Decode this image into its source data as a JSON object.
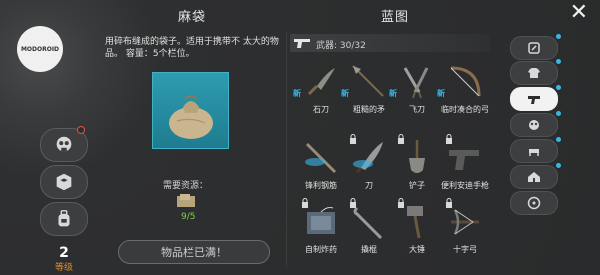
{
  "header": {
    "left_title": "麻袋",
    "right_title": "蓝图"
  },
  "logo_text": "MODOROID",
  "item": {
    "description": "用碎布缝成的袋子。适用于携带不 太大的物品。 容量：5个栏位。",
    "required_label": "需要资源：",
    "resource_count": "9/5",
    "action_button": "物品栏已满！"
  },
  "player": {
    "level": "2",
    "level_label": "等级"
  },
  "category": {
    "icon": "pistol-icon",
    "label": "武器: 30/32"
  },
  "blueprints": [
    {
      "name": "石刀",
      "new": "新",
      "locked": false,
      "icon": "stone-knife-icon"
    },
    {
      "name": "粗糙的矛",
      "new": "新",
      "locked": false,
      "icon": "crude-spear-icon"
    },
    {
      "name": "飞刀",
      "new": "新",
      "locked": false,
      "icon": "throwing-knives-icon"
    },
    {
      "name": "临时凑合的弓",
      "new": "新",
      "locked": false,
      "icon": "makeshift-bow-icon"
    },
    {
      "name": "锋利钢筋",
      "new": "",
      "locked": false,
      "icon": "sharp-rebar-icon"
    },
    {
      "name": "刀",
      "new": "",
      "locked": true,
      "icon": "machete-icon"
    },
    {
      "name": "铲子",
      "new": "",
      "locked": true,
      "icon": "shovel-icon"
    },
    {
      "name": "便利安迪手枪",
      "new": "",
      "locked": true,
      "icon": "pistol-icon"
    },
    {
      "name": "自制炸药",
      "new": "",
      "locked": true,
      "icon": "explosives-icon"
    },
    {
      "name": "撬棍",
      "new": "",
      "locked": true,
      "icon": "crowbar-icon"
    },
    {
      "name": "大锤",
      "new": "",
      "locked": true,
      "icon": "sledgehammer-icon"
    },
    {
      "name": "十字弓",
      "new": "",
      "locked": true,
      "icon": "crossbow-icon"
    }
  ],
  "right_tabs": [
    "tools-tab-icon",
    "clothing-tab-icon",
    "weapons-tab-icon",
    "medical-tab-icon",
    "furniture-tab-icon",
    "building-tab-icon",
    "vehicle-tab-icon"
  ],
  "colors": {
    "accent_blue": "#39b5e8",
    "resource_green": "#7bd14a",
    "level_orange": "#e08a2a"
  }
}
